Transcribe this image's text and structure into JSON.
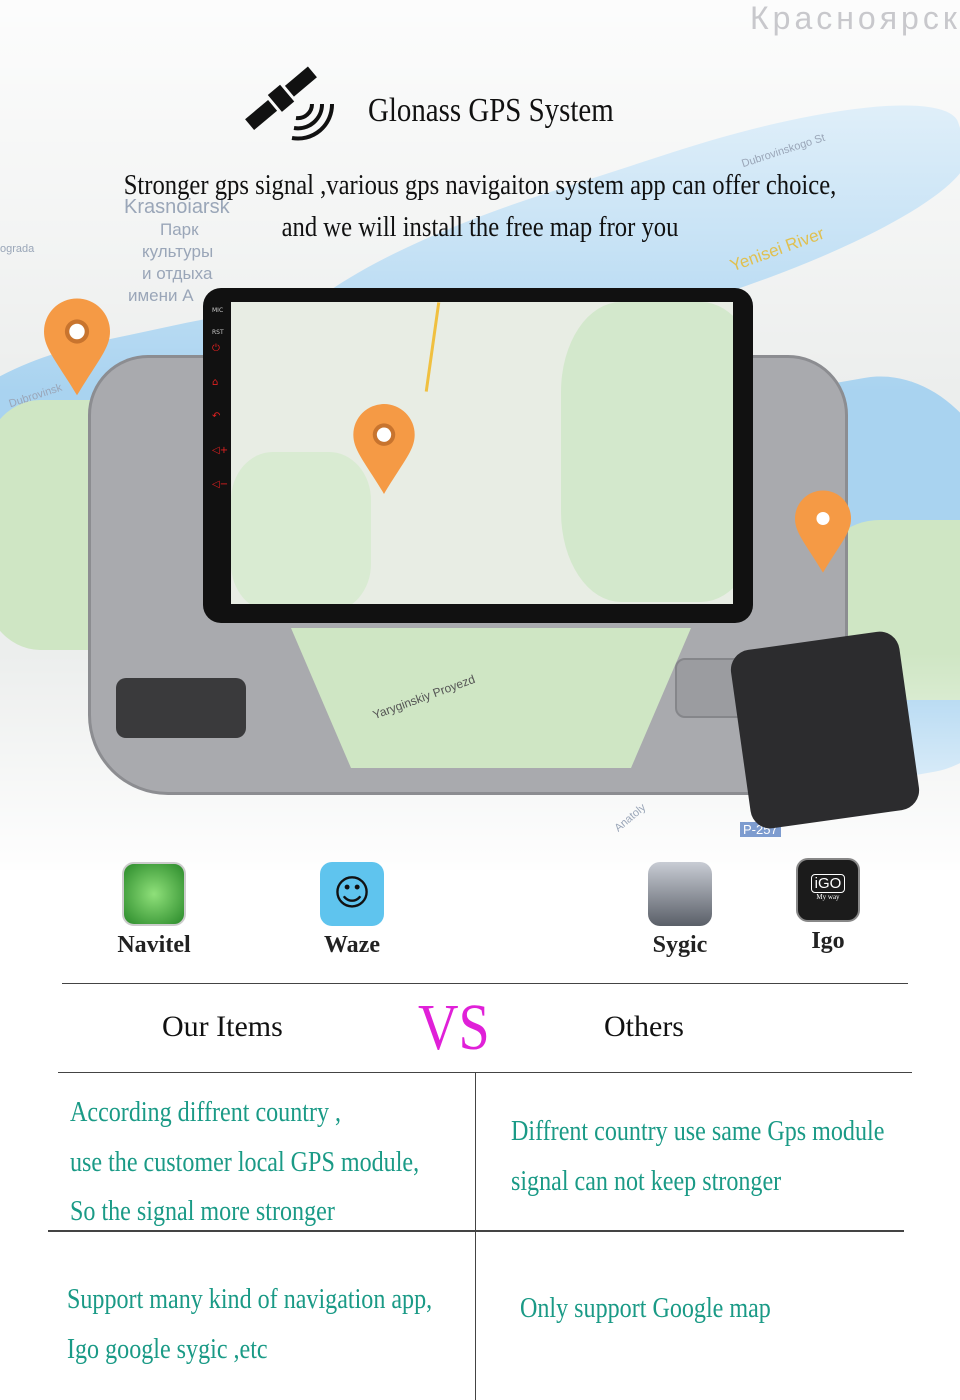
{
  "header": {
    "title": "Glonass GPS System",
    "subtitle_line1": "Stronger gps signal ,various gps navigaiton system app can  offer choice,",
    "subtitle_line2": "and we will install the free map fror you"
  },
  "map_labels": [
    "Красноярск",
    "Krasnoiarsk",
    "Парк",
    "культуры",
    "и отдыха",
    "имени А",
    "Yenisei River",
    "Dubrovinskogo St",
    "Dubrovinsk",
    "Yaryginskiy Proyezd",
    "P-257",
    "Anatoly",
    "ograda",
    "Yeni"
  ],
  "device": {
    "side_buttons": [
      "MIC",
      "RST"
    ]
  },
  "apps": [
    {
      "label": "Navitel",
      "icon": "navitel-icon",
      "color": "#3aa33a"
    },
    {
      "label": "Waze",
      "icon": "waze-icon",
      "color": "#5fc4ee"
    },
    {
      "label": "Sygic",
      "icon": "sygic-icon",
      "color": "#8a8f99"
    },
    {
      "label": "Igo",
      "icon": "igo-icon",
      "color": "#1b1b1b",
      "badge": "iGO",
      "badge_sub": "My way"
    }
  ],
  "comparison": {
    "left_header": "Our Items",
    "vs": "VS",
    "right_header": "Others",
    "rows": [
      {
        "ours": [
          "According diffrent country ,",
          "use the customer local GPS module,",
          "So the signal more stronger"
        ],
        "others": [
          "Diffrent country use same Gps module",
          "signal can not keep stronger"
        ]
      },
      {
        "ours": [
          "Support many kind of navigation app,",
          "Igo google sygic ,etc"
        ],
        "others": [
          "Only support Google map"
        ]
      }
    ]
  },
  "colors": {
    "accent_text": "#1a9a86",
    "vs": "#e020d8",
    "pin": "#f59a45"
  }
}
